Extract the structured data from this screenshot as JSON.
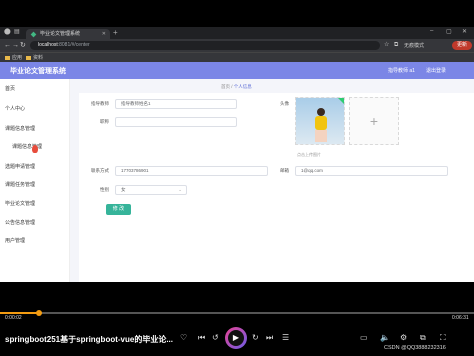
{
  "browser": {
    "tab_title": "毕业论文管理系统",
    "url_host": "localhost",
    "url_path": ":8081/#/center",
    "profile": "无痕模式",
    "update_label": "更新"
  },
  "bookmarks": [
    "应用",
    "资料"
  ],
  "app": {
    "title": "毕业论文管理系统",
    "user": "指导教师 a1",
    "logout": "退出登录"
  },
  "sidebar": {
    "items": [
      {
        "label": "首页"
      },
      {
        "label": "个人中心"
      },
      {
        "label": "课题信息管理"
      },
      {
        "label": "课题信息管理"
      },
      {
        "label": "选题申请管理"
      },
      {
        "label": "课题任务管理"
      },
      {
        "label": "毕业论文管理"
      },
      {
        "label": "公告信息管理"
      },
      {
        "label": "用户管理"
      }
    ]
  },
  "breadcrumb": {
    "home": "首页",
    "sep": "/",
    "current": "个人信息"
  },
  "form": {
    "teacher_no_label": "指导教师",
    "teacher_no_value": "指导教师姓名1",
    "title_label": "职称",
    "avatar_label": "头像",
    "upload_note": "点击上传图片",
    "phone_label": "联系方式",
    "phone_value": "17703786901",
    "email_label": "邮箱",
    "email_value": "1@qq.com",
    "gender_label": "性别",
    "gender_value": "女",
    "submit_label": "修 改"
  },
  "player": {
    "current_time": "0:00:02",
    "total_time": "0:06:31",
    "progress": 0.083,
    "video_title": "springboot251基于springboot-vue的毕业论...",
    "watermark": "CSDN @QQ3888232316"
  },
  "colors": {
    "header": "#7b86e6",
    "accent": "#36b49a",
    "progress": "#f39c12"
  }
}
